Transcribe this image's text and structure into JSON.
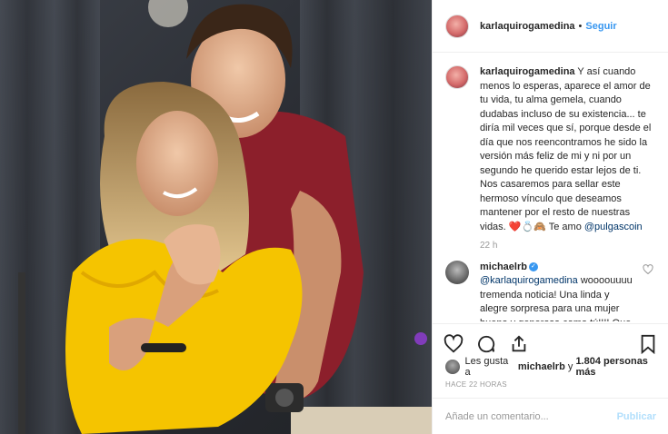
{
  "post": {
    "photo_alt": "Couple photo",
    "author": "karlaquirogamedina",
    "separator": "•",
    "follow_label": "Seguir"
  },
  "caption": {
    "username": "karlaquirogamedina",
    "text": "Y así cuando menos lo esperas, aparece el amor de tu vida, tu alma gemela, cuando dudabas incluso de su existencia... te diría mil veces que sí, porque desde el día que nos reencontramos he sido la versión más feliz de mi y ni por un segundo he querido estar lejos de ti. Nos casaremos para sellar este hermoso vínculo que deseamos mantener por el resto de nuestras vidas. ❤️💍🙈 Te amo",
    "mention": "@pulgascoin",
    "time": "22 h"
  },
  "comment": {
    "username": "michaelrb",
    "mention": "@karlaquirogamedina",
    "text": "woooouuuu tremenda noticia! Una linda y alegre sorpresa para una mujer buena y generosa como tú!!!! Que sigan las cosas"
  },
  "likes": {
    "prefix": "Les gusta a",
    "user": "michaelrb",
    "middle": "y",
    "count": "1.804 personas más"
  },
  "time_ago": "HACE 22 HORAS",
  "add_comment": {
    "placeholder": "Añade un comentario...",
    "publish_label": "Publicar"
  },
  "icons": [
    "heart-icon",
    "comment-icon",
    "share-icon",
    "bookmark-icon",
    "verified-icon",
    "heart-small-icon"
  ],
  "colors": {
    "link": "#3897f0",
    "mention": "#003569",
    "muted": "#999999",
    "publish_disabled": "#b2dffc"
  }
}
